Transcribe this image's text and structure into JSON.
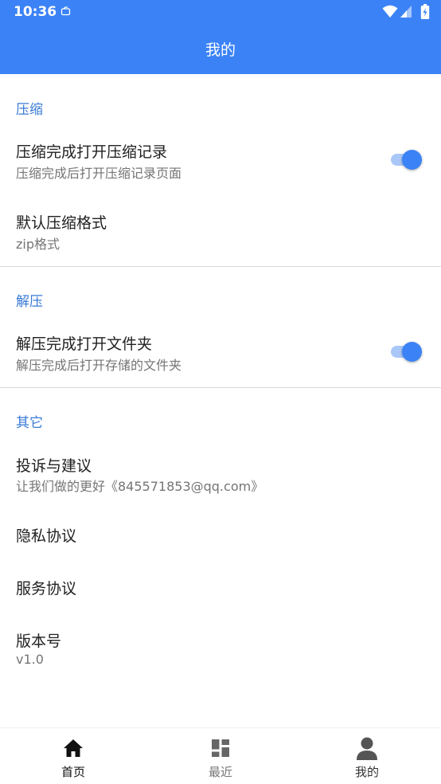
{
  "status_bar": {
    "time": "10:36"
  },
  "header": {
    "title": "我的"
  },
  "sections": {
    "compress": {
      "header": "压缩",
      "open_record": {
        "title": "压缩完成打开压缩记录",
        "subtitle": "压缩完成后打开压缩记录页面",
        "enabled": true
      },
      "default_format": {
        "title": "默认压缩格式",
        "subtitle": "zip格式"
      }
    },
    "extract": {
      "header": "解压",
      "open_folder": {
        "title": "解压完成打开文件夹",
        "subtitle": "解压完成后打开存储的文件夹",
        "enabled": true
      }
    },
    "other": {
      "header": "其它",
      "feedback": {
        "title": "投诉与建议",
        "subtitle": "让我们做的更好《845571853@qq.com》"
      },
      "privacy": {
        "title": "隐私协议"
      },
      "service": {
        "title": "服务协议"
      },
      "version": {
        "title": "版本号",
        "subtitle": "v1.0"
      }
    }
  },
  "bottom_nav": {
    "items": [
      {
        "label": "首页",
        "icon": "home-icon"
      },
      {
        "label": "最近",
        "icon": "dashboard-icon"
      },
      {
        "label": "我的",
        "icon": "person-icon"
      }
    ]
  },
  "colors": {
    "primary": "#3b82f6",
    "section_header": "#3a7bd5",
    "switch_track": "#a9c7f7"
  }
}
